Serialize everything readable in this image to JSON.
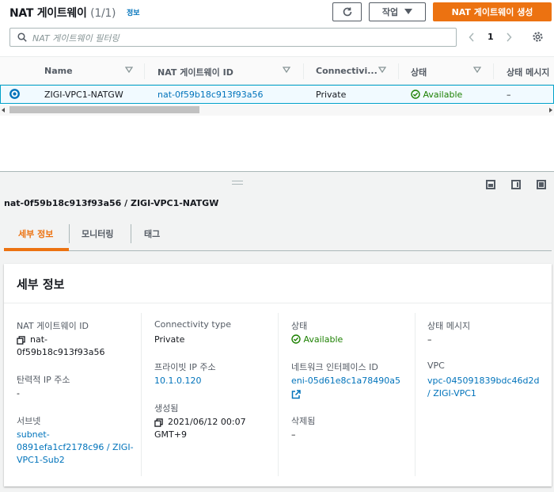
{
  "header": {
    "title": "NAT 게이트웨이",
    "count": "(1/1)",
    "info": "정보",
    "action_label": "작업",
    "create_label": "NAT 게이트웨이 생성"
  },
  "search": {
    "placeholder": "NAT 게이트웨이 필터링"
  },
  "pager": {
    "page": "1"
  },
  "table": {
    "columns": [
      "Name",
      "NAT 게이트웨이 ID",
      "Connectivi...",
      "상태",
      "상태 메시지"
    ],
    "row": {
      "name": "ZIGI-VPC1-NATGW",
      "id": "nat-0f59b18c913f93a56",
      "connectivity": "Private",
      "state": "Available",
      "message": "–"
    }
  },
  "detail": {
    "title": "nat-0f59b18c913f93a56 / ZIGI-VPC1-NATGW",
    "tabs": [
      "세부 정보",
      "모니터링",
      "태그"
    ],
    "card_title": "세부 정보",
    "fields": {
      "nat_id_label": "NAT 게이트웨이 ID",
      "nat_id_line1": "nat-",
      "nat_id_line2": "0f59b18c913f93a56",
      "eip_label": "탄력적 IP 주소",
      "eip_value": "-",
      "subnet_label": "서브넷",
      "subnet_line1": "subnet-",
      "subnet_line2": "0891efa1cf2178c96 / ZIGI-",
      "subnet_line3": "VPC1-Sub2",
      "conn_label": "Connectivity type",
      "conn_value": "Private",
      "private_ip_label": "프라이빗 IP 주소",
      "private_ip_value": "10.1.0.120",
      "created_label": "생성됨",
      "created_line1": "2021/06/12 00:07",
      "created_line2": "GMT+9",
      "state_label": "상태",
      "state_value": "Available",
      "eni_label": "네트워크 인터페이스 ID",
      "eni_value": "eni-05d61e8c1a78490a5",
      "deleted_label": "삭제됨",
      "deleted_value": "–",
      "msg_label": "상태 메시지",
      "msg_value": "–",
      "vpc_label": "VPC",
      "vpc_line1": "vpc-045091839bdc46d2d",
      "vpc_line2": "/ ZIGI-VPC1"
    }
  },
  "colors": {
    "accent": "#ec7211",
    "link": "#0073bb",
    "success": "#1d8102",
    "selected_row": "#f1faff"
  },
  "icons": [
    "refresh-icon",
    "caret-down-icon",
    "search-icon",
    "chevron-left-icon",
    "chevron-right-icon",
    "gear-icon",
    "sort-icon",
    "radio-icon",
    "check-circle-icon",
    "copy-icon",
    "external-link-icon",
    "panel-icon"
  ]
}
